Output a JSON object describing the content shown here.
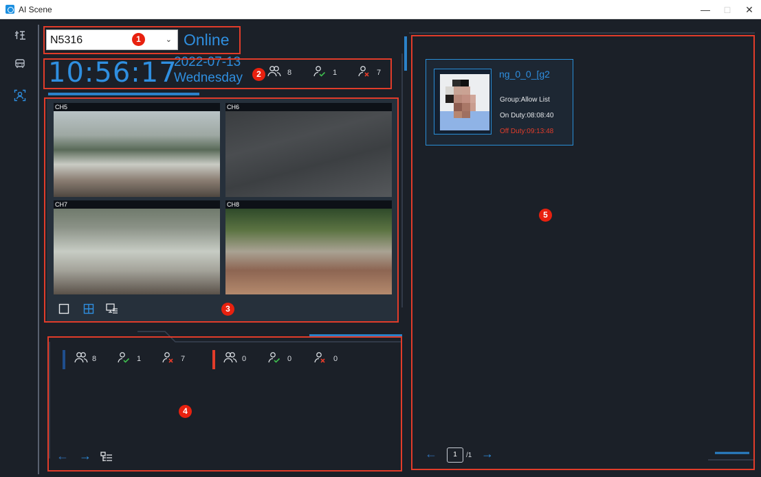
{
  "window": {
    "title": "AI Scene",
    "controls": {
      "minimize": "—",
      "maximize": "□",
      "close": "✕"
    }
  },
  "nav": {
    "items": [
      {
        "id": "attendance",
        "icon": "attendance-icon"
      },
      {
        "id": "vehicle",
        "icon": "vehicle-icon"
      },
      {
        "id": "face",
        "icon": "face-recognition-icon",
        "active": true
      }
    ]
  },
  "device": {
    "name": "N5316",
    "status": "Online"
  },
  "clock": {
    "time": "10:56:17",
    "date": "2022-07-13",
    "weekday": "Wednesday"
  },
  "summary": {
    "total": "8",
    "present": "1",
    "absent": "7"
  },
  "channels": [
    {
      "label": "CH5"
    },
    {
      "label": "CH6"
    },
    {
      "label": "CH7"
    },
    {
      "label": "CH8"
    }
  ],
  "layout_options": [
    "single-view-icon",
    "quad-view-icon",
    "custom-layout-icon"
  ],
  "groups": [
    {
      "total": "8",
      "present": "1",
      "absent": "7",
      "color": "#1f4e8c"
    },
    {
      "total": "0",
      "present": "0",
      "absent": "0",
      "color": "#e23c2a"
    }
  ],
  "card": {
    "name": "ng_0_0_[g2",
    "group": "Group:Allow List",
    "on_duty": "On Duty:08:08:40",
    "off_duty": "Off Duty:09:13:48",
    "off_duty_color": "#e23c2a"
  },
  "pagination": {
    "current": "1",
    "total": "/1"
  },
  "annotations": [
    "1",
    "2",
    "3",
    "4",
    "5"
  ],
  "colors": {
    "accent": "#2f8fe0",
    "annotation": "#e23c2a",
    "background": "#1b2028"
  }
}
